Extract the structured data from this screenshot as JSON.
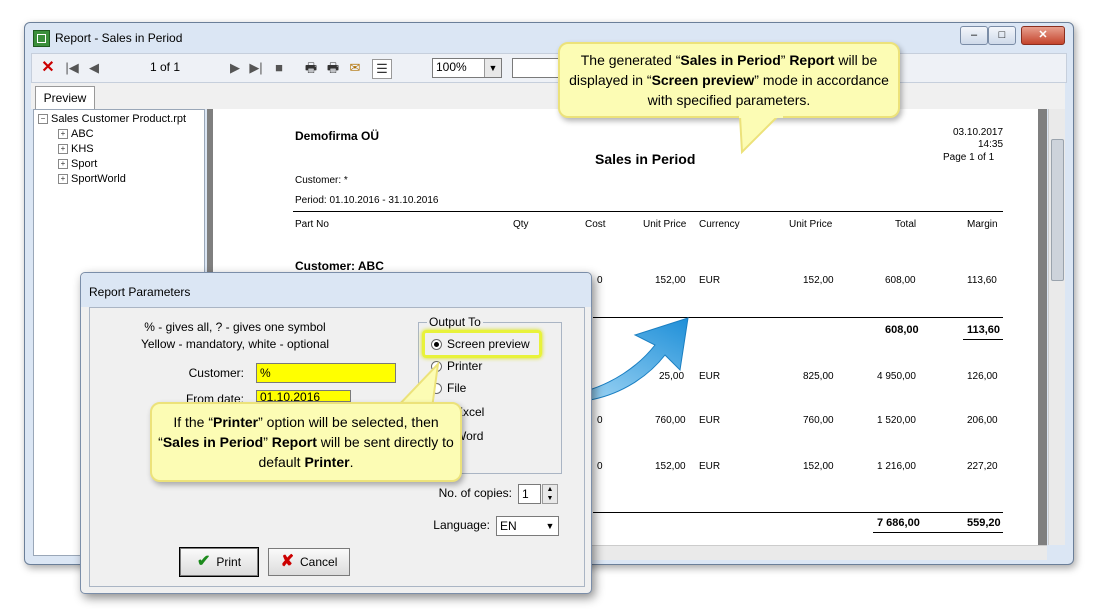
{
  "window": {
    "title": "Report - Sales in Period",
    "minimize": "–",
    "maximize": "□",
    "close": "✕"
  },
  "toolbar": {
    "page_indicator": "1 of 1",
    "zoom": "100%",
    "icons": [
      "close-icon",
      "first-page-icon",
      "prev-page-icon",
      "next-page-icon",
      "last-page-icon",
      "stop-icon",
      "print-icon",
      "print-setup-icon",
      "export-icon",
      "tree-toggle-icon"
    ]
  },
  "tabs": {
    "preview": "Preview"
  },
  "tree": {
    "root": "Sales Customer Product.rpt",
    "children": [
      "ABC",
      "KHS",
      "Sport",
      "SportWorld"
    ]
  },
  "report": {
    "company": "Demofirma OÜ",
    "title": "Sales in Period",
    "date": "03.10.2017",
    "time": "14:35",
    "page": "Page 1 of 1",
    "customer_line": "Customer: *",
    "period_line": "Period: 01.10.2016 - 31.10.2016",
    "columns": [
      "Part No",
      "Qty",
      "Cost",
      "Unit Price",
      "Currency",
      "Unit Price",
      "Total",
      "Margin"
    ],
    "customer_header": "Customer: ABC",
    "rows": [
      {
        "frag": "0",
        "unit_price": "152,00",
        "currency": "EUR",
        "unit_price2": "152,00",
        "total": "608,00",
        "margin": "113,60"
      },
      {
        "frag": "",
        "unit_price": "",
        "currency": "",
        "unit_price2": "",
        "total": "608,00",
        "margin": "113,60"
      },
      {
        "frag": "",
        "unit_price": "25,00",
        "currency": "EUR",
        "unit_price2": "825,00",
        "total": "4 950,00",
        "margin": "126,00"
      },
      {
        "frag": "0",
        "unit_price": "760,00",
        "currency": "EUR",
        "unit_price2": "760,00",
        "total": "1 520,00",
        "margin": "206,00"
      },
      {
        "frag": "0",
        "unit_price": "152,00",
        "currency": "EUR",
        "unit_price2": "152,00",
        "total": "1 216,00",
        "margin": "227,20"
      }
    ],
    "grand_total": "7 686,00",
    "grand_margin": "559,20",
    "hscroll_grip": "III"
  },
  "dialog": {
    "title": "Report Parameters",
    "hint_line1": "% - gives all, ? - gives one symbol",
    "hint_line2": "Yellow - mandatory, white - optional",
    "customer_label": "Customer:",
    "customer_value": "%",
    "from_date_label": "From date:",
    "from_date_value": "01.10.2016",
    "output_group": "Output To",
    "output_options": [
      "Screen preview",
      "Printer",
      "File",
      "Excel",
      "Word"
    ],
    "copies_label": "No. of copies:",
    "copies_value": "1",
    "language_label": "Language:",
    "language_value": "EN",
    "print_button": "Print",
    "cancel_button": "Cancel"
  },
  "callouts": {
    "top": {
      "t1": "The generated “",
      "b1": "Sales in Period",
      "t2": "” ",
      "b2": "Report",
      "t3": " will be displayed in “",
      "b3": "Screen preview",
      "t4": "” mode in accordance with specified parameters."
    },
    "bottom": {
      "t1": "If the “",
      "b1": "Printer",
      "t2": "” option will be selected, then “",
      "b2": "Sales in Period",
      "t3": "” ",
      "b3": "Report",
      "t4": " will be sent directly to default ",
      "b4": "Printer",
      "t5": "."
    }
  },
  "colors": {
    "mandatory_field": "#ffff00",
    "callout_bg": "#fcfcb4",
    "arrow": "#2aa0e0"
  }
}
